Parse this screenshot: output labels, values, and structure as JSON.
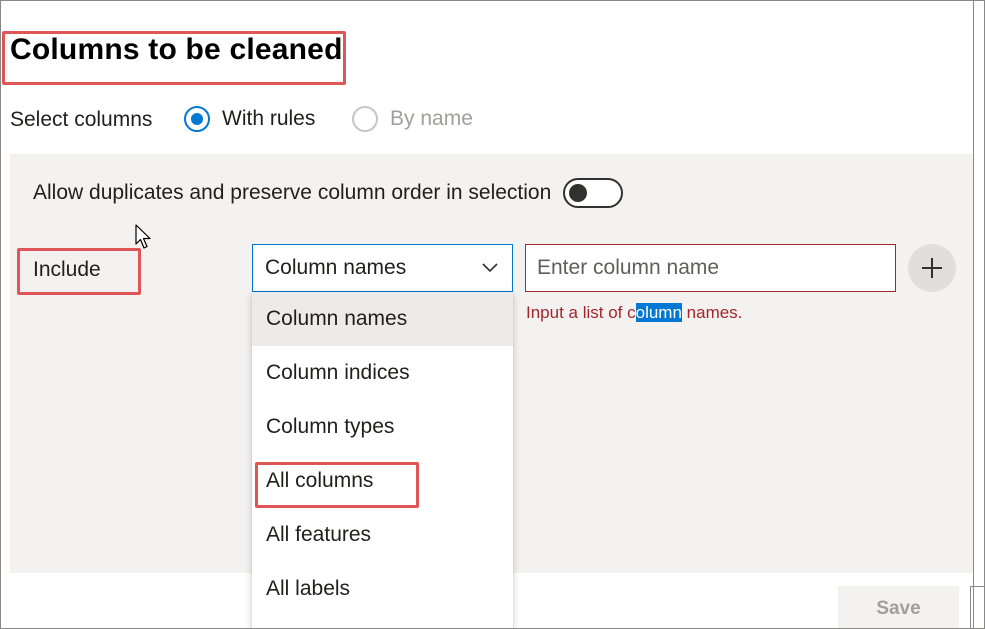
{
  "page": {
    "title": "Columns to be cleaned"
  },
  "column_selection": {
    "label": "Select columns",
    "options": [
      {
        "label": "With rules",
        "checked": true,
        "disabled": false
      },
      {
        "label": "By name",
        "checked": false,
        "disabled": true
      }
    ]
  },
  "rules": {
    "toggle_label": "Allow duplicates and preserve column order in selection",
    "toggle_on": false,
    "include_label": "Include",
    "dropdown_value": "Column names",
    "input_placeholder": "Enter column name",
    "error": {
      "before": "Input a list of c",
      "highlight": "olumn",
      "after": " names."
    },
    "menu_items": [
      "Column names",
      "Column indices",
      "Column types",
      "All columns",
      "All features",
      "All labels"
    ]
  },
  "footer": {
    "save_label": "Save"
  },
  "colors": {
    "accent": "#0078d4",
    "error": "#a4262c",
    "callout": "#e05555",
    "panel": "#f3f2f1"
  },
  "icons": [
    "chevron-down-icon",
    "plus-icon",
    "mouse-cursor-icon"
  ]
}
